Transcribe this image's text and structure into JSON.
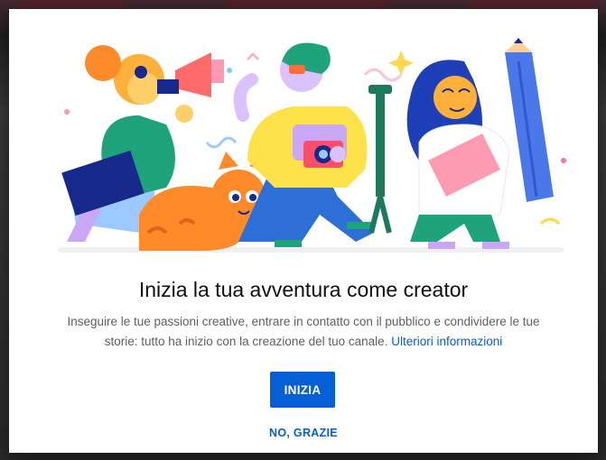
{
  "dialog": {
    "title": "Inizia la tua avventura come creator",
    "description_text": "Inseguire le tue passioni creative, entrare in contatto con il pubblico e condividere le tue storie: tutto ha inizio con la creazione del tuo canale. ",
    "learn_more_link": "Ulteriori informazioni",
    "start_button_label": "INIZIA",
    "decline_button_label": "NO, GRAZIE"
  },
  "colors": {
    "accent": "#065fd4",
    "title": "#0f0f0f",
    "description": "#606060"
  }
}
